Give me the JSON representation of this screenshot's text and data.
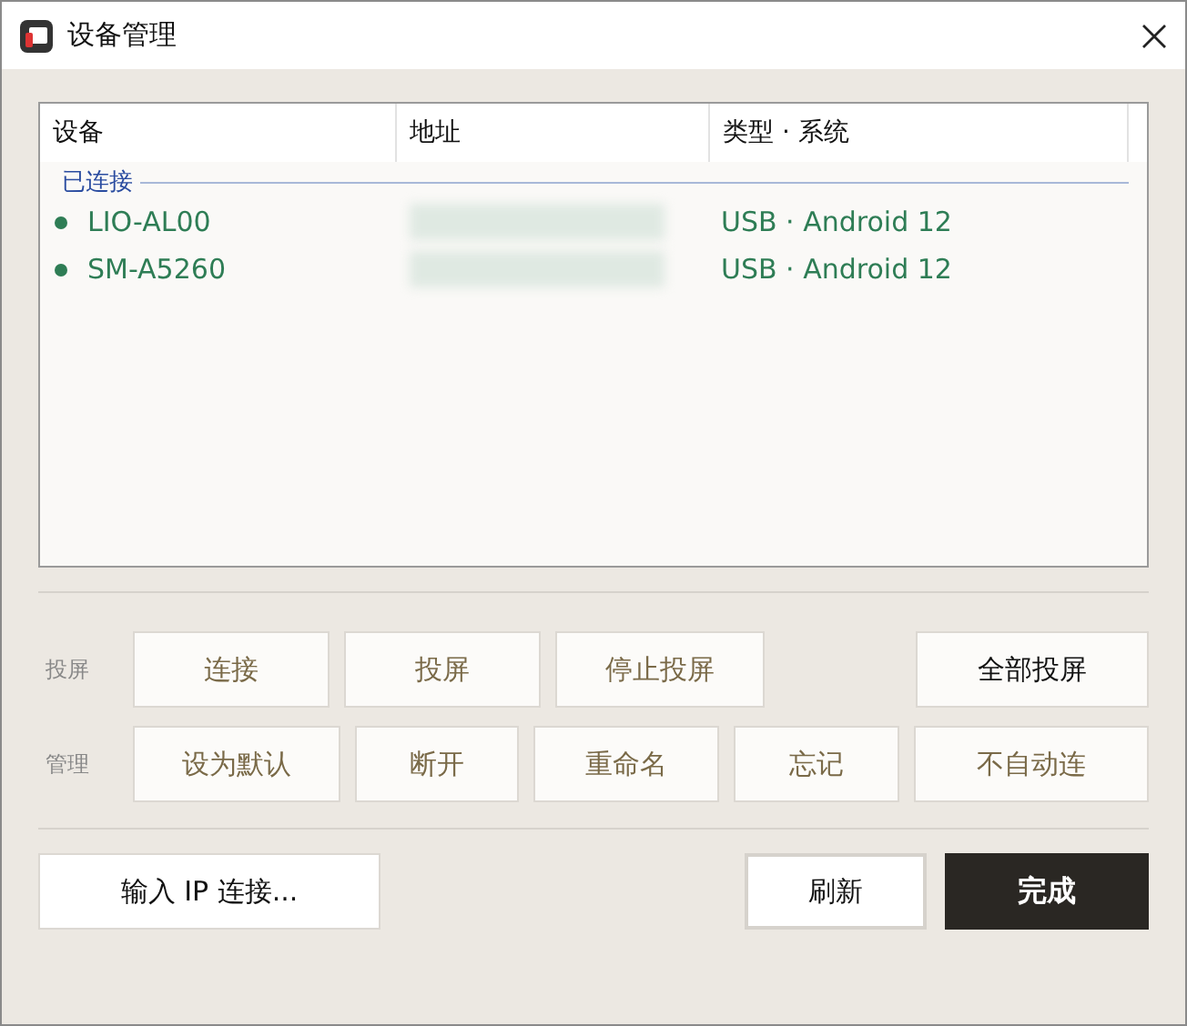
{
  "window": {
    "title": "设备管理"
  },
  "table": {
    "columns": [
      "设备",
      "地址",
      "类型 · 系统"
    ],
    "groups": [
      {
        "label": "已连接",
        "rows": [
          {
            "device": "LIO-AL00",
            "connection": "USB · Android 12",
            "color": "#2e7d55"
          },
          {
            "device": "SM-A5260",
            "connection": "USB · Android 12",
            "color": "#2e7d55"
          }
        ]
      }
    ]
  },
  "action_rows": [
    {
      "label": "投屏",
      "buttons": [
        {
          "label": "连接",
          "disabled": true
        },
        {
          "label": "投屏",
          "disabled": true
        },
        {
          "label": "停止投屏",
          "disabled": true
        },
        {
          "label": "全部投屏",
          "disabled": false
        }
      ]
    },
    {
      "label": "管理",
      "buttons": [
        {
          "label": "设为默认",
          "disabled": true
        },
        {
          "label": "断开",
          "disabled": true
        },
        {
          "label": "重命名",
          "disabled": true
        },
        {
          "label": "忘记",
          "disabled": true
        },
        {
          "label": "不自动连",
          "disabled": true
        }
      ]
    }
  ],
  "footer": {
    "ip_button": "输入 IP 连接...",
    "refresh_button": "刷新",
    "done_button": "完成"
  }
}
